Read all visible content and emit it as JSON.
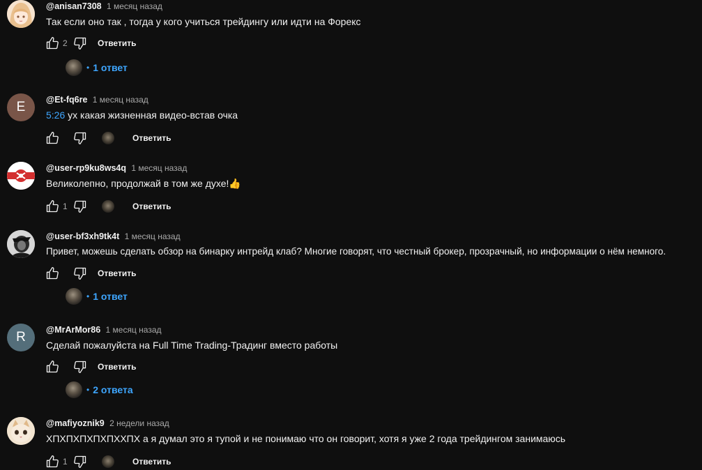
{
  "colors": {
    "background": "#0f0f0f",
    "text": "#f1f1f1",
    "secondary_text": "#aaaaaa",
    "link": "#3ea6ff"
  },
  "comments": [
    {
      "author": "@anisan7308",
      "date": "1 месяц назад",
      "timestamp": "",
      "text": "Так если оно так , тогда у кого учиться трейдингу или идти на Форекс",
      "likes": "2",
      "reply_label": "Ответить",
      "replies_label": "1 ответ",
      "avatar": {
        "type": "anime-girl-avatar",
        "color": "#e9c9a8"
      }
    },
    {
      "author": "@Et-fq6re",
      "date": "1 месяц назад",
      "timestamp": "5:26",
      "text": " ух какая жизненная видео-встав очка",
      "likes": "",
      "reply_label": "Ответить",
      "replies_label": "",
      "avatar": {
        "type": "letter-avatar",
        "letter": "E",
        "color": "#795548"
      }
    },
    {
      "author": "@user-rp9ku8ws4q",
      "date": "1 месяц назад",
      "timestamp": "",
      "text": "Великолепно, продолжай в том же духе!👍",
      "likes": "1",
      "reply_label": "Ответить",
      "replies_label": "",
      "avatar": {
        "type": "flag-emblem-avatar",
        "color": "#d32f2f"
      }
    },
    {
      "author": "@user-bf3xh9tk4t",
      "date": "1 месяц назад",
      "timestamp": "",
      "text": "Привет, можешь сделать обзор на бинарку интрейд клаб? Многие говорят, что честный брокер, прозрачный, но информации о нём немного.",
      "likes": "",
      "reply_label": "Ответить",
      "replies_label": "1 ответ",
      "avatar": {
        "type": "bw-photo-avatar",
        "color": "#cfcfcf"
      }
    },
    {
      "author": "@MrArMor86",
      "date": "1 месяц назад",
      "timestamp": "",
      "text": "Сделай пожалуйста на Full Time Trading-Традинг вместо работы",
      "likes": "",
      "reply_label": "Ответить",
      "replies_label": "2 ответа",
      "avatar": {
        "type": "letter-avatar",
        "letter": "R",
        "color": "#546e7a"
      }
    },
    {
      "author": "@mafiyoznik9",
      "date": "2 недели назад",
      "timestamp": "",
      "text": "ХПХПХПХПХПХХПХ а я думал это я тупой и не понимаю что он говорит, хотя я уже 2 года трейдингом занимаюсь",
      "likes": "1",
      "reply_label": "Ответить",
      "replies_label": "",
      "avatar": {
        "type": "cat-photo-avatar",
        "color": "#e8d3b8"
      }
    }
  ]
}
